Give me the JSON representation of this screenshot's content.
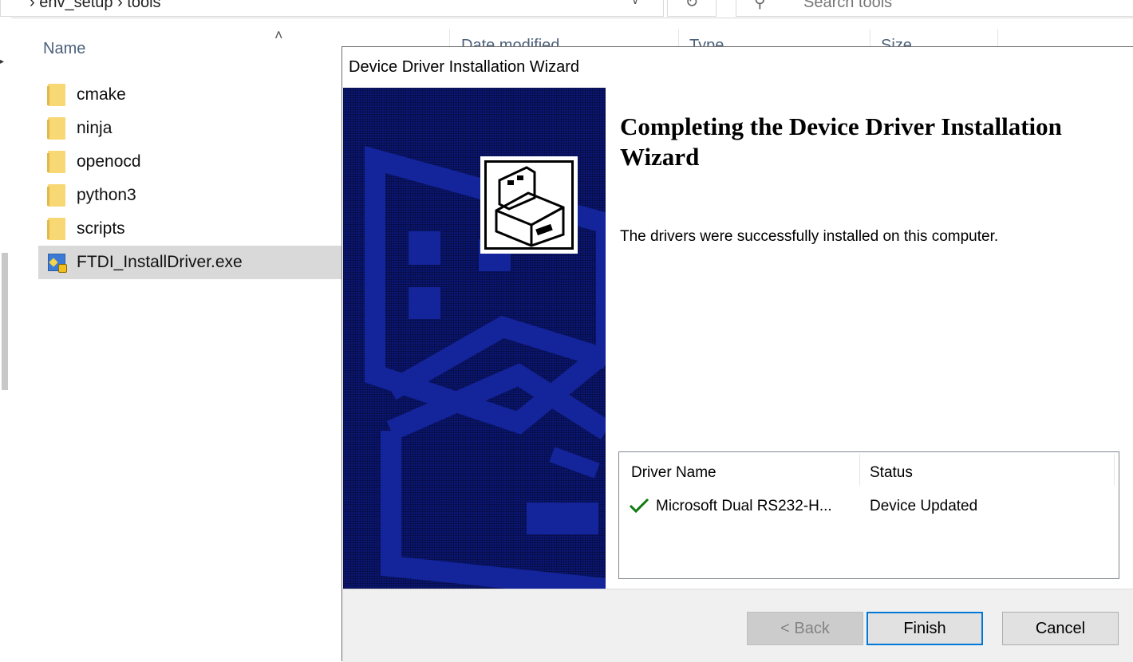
{
  "explorer": {
    "breadcrumb": "›   env_setup   ›   tools",
    "search_placeholder": "Search tools",
    "columns": {
      "name": "Name",
      "date": "Date modified",
      "type": "Type",
      "size": "Size"
    },
    "files": [
      {
        "name": "cmake",
        "kind": "folder"
      },
      {
        "name": "ninja",
        "kind": "folder"
      },
      {
        "name": "openocd",
        "kind": "folder"
      },
      {
        "name": "python3",
        "kind": "folder"
      },
      {
        "name": "scripts",
        "kind": "folder"
      },
      {
        "name": "FTDI_InstallDriver.exe",
        "kind": "exe",
        "selected": true
      }
    ]
  },
  "wizard": {
    "title": "Device Driver Installation Wizard",
    "heading": "Completing the Device Driver Installation Wizard",
    "message": "The drivers were successfully installed on this computer.",
    "table": {
      "headers": {
        "name": "Driver Name",
        "status": "Status"
      },
      "rows": [
        {
          "name": "Microsoft Dual RS232-H...",
          "status": "Device Updated",
          "icon": "check-icon",
          "icon_color": "#107c10"
        }
      ]
    },
    "buttons": {
      "back": "< Back",
      "finish": "Finish",
      "cancel": "Cancel"
    },
    "colors": {
      "banner": "#0a1670",
      "accent": "#0078d7"
    }
  }
}
